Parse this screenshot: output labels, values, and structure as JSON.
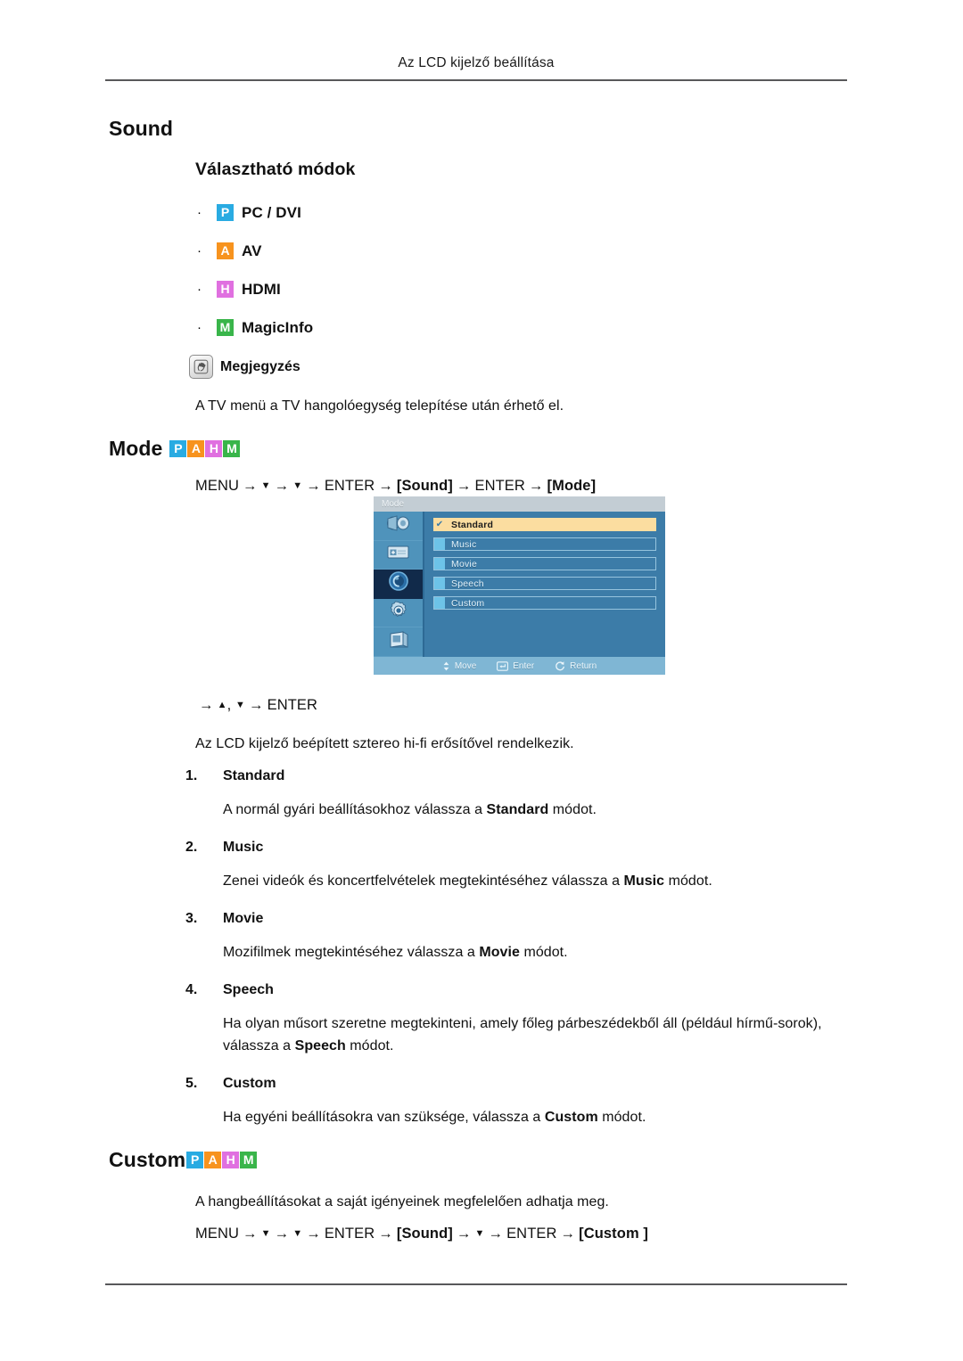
{
  "header": {
    "running_head": "Az LCD kijelző beállítása"
  },
  "sections": {
    "sound_heading": "Sound",
    "modes_heading": "Választható módok",
    "mode_heading": "Mode",
    "custom_heading": "Custom"
  },
  "mode_list": [
    {
      "bullet": "·",
      "badge": "P",
      "badge_color": "#29abe2",
      "label": "PC / DVI"
    },
    {
      "bullet": "·",
      "badge": "A",
      "badge_color": "#f7931e",
      "label": "AV"
    },
    {
      "bullet": "·",
      "badge": "H",
      "badge_color": "#e070e0",
      "label": "HDMI"
    },
    {
      "bullet": "·",
      "badge": "M",
      "badge_color": "#39b54a",
      "label": "MagicInfo"
    }
  ],
  "badges": {
    "p": "P",
    "a": "A",
    "h": "H",
    "m": "M"
  },
  "note": {
    "icon": "note-pen-icon",
    "label": "Megjegyzés",
    "text": "A TV menü a TV hangolóegység telepítése után érhető el."
  },
  "paths": {
    "mode": {
      "menu": "MENU",
      "down1": "▼",
      "down2": "▼",
      "enter1": "ENTER",
      "sound": "[Sound]",
      "enter2": "ENTER",
      "target": "[Mode]"
    },
    "enter_line": {
      "up": "▲",
      "comma": ",",
      "down": "▼",
      "enter": "ENTER"
    },
    "custom": {
      "menu": "MENU",
      "down1": "▼",
      "down2": "▼",
      "enter1": "ENTER",
      "sound": "[Sound]",
      "down3": "▼",
      "enter2": "ENTER",
      "target": "[Custom ]"
    }
  },
  "osd": {
    "title": "Mode",
    "sidebar_icons": [
      "picture-icon",
      "screen-icon",
      "sound-icon",
      "setup-icon",
      "multi-control-icon"
    ],
    "active_sidebar_index": 2,
    "rows": [
      {
        "label": "Standard",
        "selected": true,
        "check": "✔"
      },
      {
        "label": "Music",
        "selected": false,
        "check": ""
      },
      {
        "label": "Movie",
        "selected": false,
        "check": ""
      },
      {
        "label": "Speech",
        "selected": false,
        "check": ""
      },
      {
        "label": "Custom",
        "selected": false,
        "check": ""
      }
    ],
    "footer": [
      {
        "icon": "move-icon",
        "label": "Move"
      },
      {
        "icon": "enter-icon",
        "label": "Enter"
      },
      {
        "icon": "return-icon",
        "label": "Return"
      }
    ],
    "colors": {
      "background": "#3c7ca8",
      "sidebar": "#4f93bb",
      "sidebar_active": "#112a4a",
      "titlebar": "#c3cdd4",
      "footer": "#7fb6d4",
      "selected_row": "#fbdda0",
      "marker": "#6dc3e8"
    }
  },
  "body": {
    "amp_intro": "Az LCD kijelző beépített sztereo hi-fi erősítővel rendelkezik.",
    "custom_intro": "A hangbeállításokat a saját igényeinek megfelelően adhatja meg."
  },
  "numbered_items": [
    {
      "index": "1.",
      "term": "Standard",
      "desc_before": "A normál gyári beállításokhoz válassza a ",
      "desc_bold": "Standard",
      "desc_after": " módot."
    },
    {
      "index": "2.",
      "term": "Music",
      "desc_before": "Zenei videók és koncertfelvételek megtekintéséhez válassza a ",
      "desc_bold": "Music",
      "desc_after": " módot."
    },
    {
      "index": "3.",
      "term": "Movie",
      "desc_before": "Mozifilmek megtekintéséhez válassza a ",
      "desc_bold": "Movie",
      "desc_after": " módot."
    },
    {
      "index": "4.",
      "term": "Speech",
      "desc_before": "Ha olyan műsort szeretne megtekinteni, amely főleg párbeszédekből áll (például hírmű-sorok), válassza a ",
      "desc_bold": "Speech",
      "desc_after": " módot."
    },
    {
      "index": "5.",
      "term": "Custom",
      "desc_before": "Ha egyéni beállításokra van szüksége, válassza a ",
      "desc_bold": "Custom",
      "desc_after": " módot."
    }
  ]
}
